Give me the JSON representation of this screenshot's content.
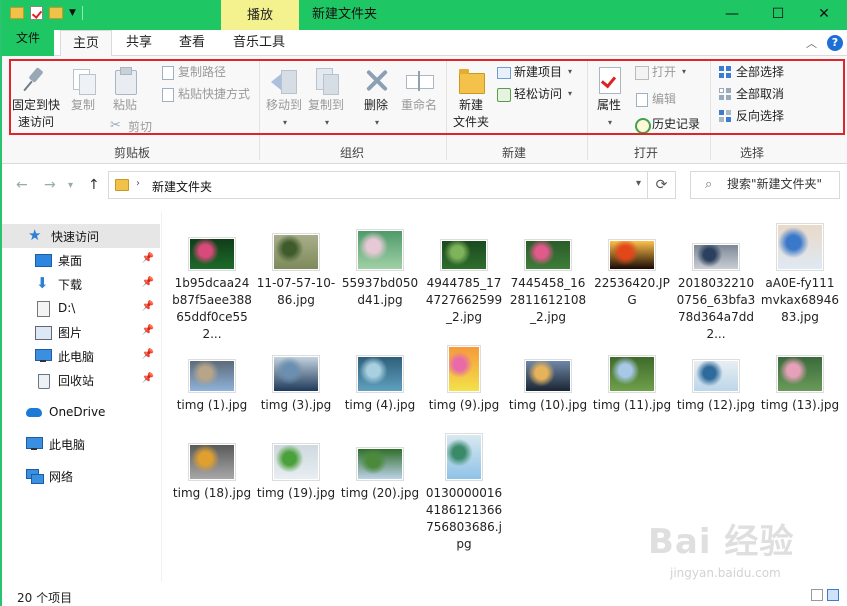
{
  "titlebar": {
    "context_tab": "播放",
    "title": "新建文件夹",
    "minimize": "—",
    "maximize": "☐",
    "close": "✕"
  },
  "tabs": {
    "file": "文件",
    "home": "主页",
    "share": "共享",
    "view": "查看",
    "music": "音乐工具"
  },
  "ribbon": {
    "clipboard": {
      "label": "剪贴板",
      "pin": "固定到快\n速访问",
      "copy": "复制",
      "paste": "粘贴",
      "copy_path": "复制路径",
      "paste_shortcut": "粘贴快捷方式",
      "cut": "剪切"
    },
    "organize": {
      "label": "组织",
      "move_to": "移动到",
      "copy_to": "复制到",
      "delete": "删除",
      "rename": "重命名"
    },
    "new": {
      "label": "新建",
      "new_folder": "新建\n文件夹",
      "new_item": "新建项目",
      "easy_access": "轻松访问"
    },
    "open": {
      "label": "打开",
      "properties": "属性",
      "open": "打开",
      "edit": "编辑",
      "history": "历史记录"
    },
    "select": {
      "label": "选择",
      "select_all": "全部选择",
      "select_none": "全部取消",
      "invert": "反向选择"
    }
  },
  "address": {
    "path": "新建文件夹",
    "search_placeholder": "搜索\"新建文件夹\""
  },
  "nav": [
    {
      "label": "快速访问",
      "icon": "star-icon",
      "pinned": false,
      "selected": true
    },
    {
      "label": "桌面",
      "icon": "desktop-icon",
      "pinned": true
    },
    {
      "label": "下载",
      "icon": "download-icon",
      "pinned": true
    },
    {
      "label": "D:\\",
      "icon": "drive-icon",
      "pinned": true
    },
    {
      "label": "图片",
      "icon": "pictures-icon",
      "pinned": true
    },
    {
      "label": "此电脑",
      "icon": "computer-icon",
      "pinned": true
    },
    {
      "label": "回收站",
      "icon": "recycle-bin-icon",
      "pinned": true
    },
    {
      "label": "OneDrive",
      "icon": "cloud-icon",
      "pinned": false
    },
    {
      "label": "此电脑",
      "icon": "computer-icon",
      "pinned": false
    },
    {
      "label": "网络",
      "icon": "network-icon",
      "pinned": false
    }
  ],
  "files": [
    {
      "name": "1b95dcaa24b87f5aee38865ddf0ce552...",
      "colors": [
        "#1e6b2a",
        "#d94a7a",
        "#0f3d18"
      ]
    },
    {
      "name": "11-07-57-10-86.jpg",
      "colors": [
        "#7d8a5a",
        "#3f5a2b",
        "#a8ae8a"
      ]
    },
    {
      "name": "55937bd050d41.jpg",
      "colors": [
        "#9fd1a6",
        "#e7c9d6",
        "#4f9a6a"
      ]
    },
    {
      "name": "4944785_174727662599_2.jpg",
      "colors": [
        "#2f6e2d",
        "#7eb35a",
        "#1a4a1e"
      ]
    },
    {
      "name": "7445458_162811612108_2.jpg",
      "colors": [
        "#3e7d3a",
        "#e05a8a",
        "#2a5c28"
      ]
    },
    {
      "name": "22536420.JPG",
      "colors": [
        "#1a0a05",
        "#e3461a",
        "#ffc04a"
      ]
    },
    {
      "name": "20180322100756_63bfa378d364a7dd2...",
      "colors": [
        "#c9ced4",
        "#2b3f5e",
        "#7d8896"
      ]
    },
    {
      "name": "aA0E-fy111mvkax6894683.jpg",
      "colors": [
        "#dfe9f2",
        "#3a78c9",
        "#e9d9c9"
      ]
    },
    {
      "name": "timg (1).jpg",
      "colors": [
        "#8fb3d9",
        "#b7a58a",
        "#5d6b7a"
      ]
    },
    {
      "name": "timg (3).jpg",
      "colors": [
        "#1e3a5a",
        "#6a8fb0",
        "#c3d2de"
      ]
    },
    {
      "name": "timg (4).jpg",
      "colors": [
        "#5fa0bf",
        "#a9d0e0",
        "#2e5f7a"
      ]
    },
    {
      "name": "timg (9).jpg",
      "colors": [
        "#f3e24a",
        "#e86aa8",
        "#f59a3a"
      ]
    },
    {
      "name": "timg (10).jpg",
      "colors": [
        "#1a2533",
        "#e7b35a",
        "#6f88a8"
      ]
    },
    {
      "name": "timg (11).jpg",
      "colors": [
        "#6fa04a",
        "#a8c8e8",
        "#3e6a2a"
      ]
    },
    {
      "name": "timg (12).jpg",
      "colors": [
        "#bcd6ea",
        "#2e6a9a",
        "#e8eef2"
      ]
    },
    {
      "name": "timg (13).jpg",
      "colors": [
        "#6a9a5a",
        "#e6a0b8",
        "#3a6a3a"
      ]
    },
    {
      "name": "timg (18).jpg",
      "colors": [
        "#a8a8a8",
        "#e0a030",
        "#5a5a5a"
      ]
    },
    {
      "name": "timg (19).jpg",
      "colors": [
        "#e8eef2",
        "#4aa03a",
        "#cfd9e0"
      ]
    },
    {
      "name": "timg (20).jpg",
      "colors": [
        "#bcd3e8",
        "#4a8a3a",
        "#2f6e2a"
      ]
    },
    {
      "name": "01300000164186121366756803686.jpg",
      "colors": [
        "#8fc3e8",
        "#3a8a6a",
        "#d9e8ef"
      ]
    }
  ],
  "status": "20 个项目",
  "watermark": {
    "logo": "Bai 经验",
    "url": "jingyan.baidu.com"
  },
  "colors": {
    "accent": "#1fc764",
    "context": "#f3f28f",
    "highlight_box": "#e0242c"
  }
}
